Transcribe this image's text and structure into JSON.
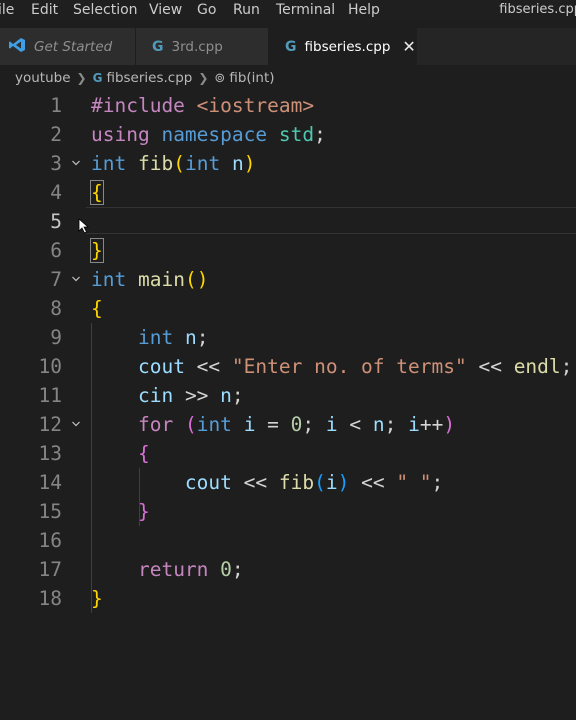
{
  "menubar": {
    "items": [
      "ile",
      "Edit",
      "Selection",
      "View",
      "Go",
      "Run",
      "Terminal",
      "Help"
    ],
    "window_title": "fibseries.cpp"
  },
  "tabs": [
    {
      "label": "Get Started",
      "icon": "vscode-icon",
      "active": false
    },
    {
      "label": "3rd.cpp",
      "icon": "cpp-icon",
      "active": false
    },
    {
      "label": "fibseries.cpp",
      "icon": "cpp-icon",
      "active": true,
      "close": "✕"
    }
  ],
  "breadcrumb": {
    "folder": "youtube",
    "file": "fibseries.cpp",
    "symbol": "fib(int)"
  },
  "cpp_glyph": "G",
  "function_glyph": "⊚",
  "editor": {
    "current_line": 5,
    "lines": [
      {
        "num": "1",
        "code": "#include <iostream>"
      },
      {
        "num": "2",
        "code": "using namespace std;"
      },
      {
        "num": "3",
        "code": "int fib(int n)"
      },
      {
        "num": "4",
        "code": "{"
      },
      {
        "num": "5",
        "code": ""
      },
      {
        "num": "6",
        "code": "}"
      },
      {
        "num": "7",
        "code": "int main()"
      },
      {
        "num": "8",
        "code": "{"
      },
      {
        "num": "9",
        "code": "    int n;"
      },
      {
        "num": "10",
        "code": "    cout << \"Enter no. of terms\" << endl;"
      },
      {
        "num": "11",
        "code": "    cin >> n;"
      },
      {
        "num": "12",
        "code": "    for (int i = 0; i < n; i++)"
      },
      {
        "num": "13",
        "code": "    {"
      },
      {
        "num": "14",
        "code": "        cout << fib(i) << \" \";"
      },
      {
        "num": "15",
        "code": "    }"
      },
      {
        "num": "16",
        "code": ""
      },
      {
        "num": "17",
        "code": "    return 0;"
      },
      {
        "num": "18",
        "code": "}"
      }
    ]
  },
  "colors": {
    "keyword": "#569cd6",
    "control": "#c586c0",
    "string": "#ce9178",
    "function": "#dcdcaa",
    "variable": "#9cdcfe",
    "type": "#4ec9b0",
    "number": "#b5cea8",
    "bracket_level1": "#ffd700",
    "bracket_level2": "#da70d6",
    "bracket_level3": "#179fff"
  }
}
